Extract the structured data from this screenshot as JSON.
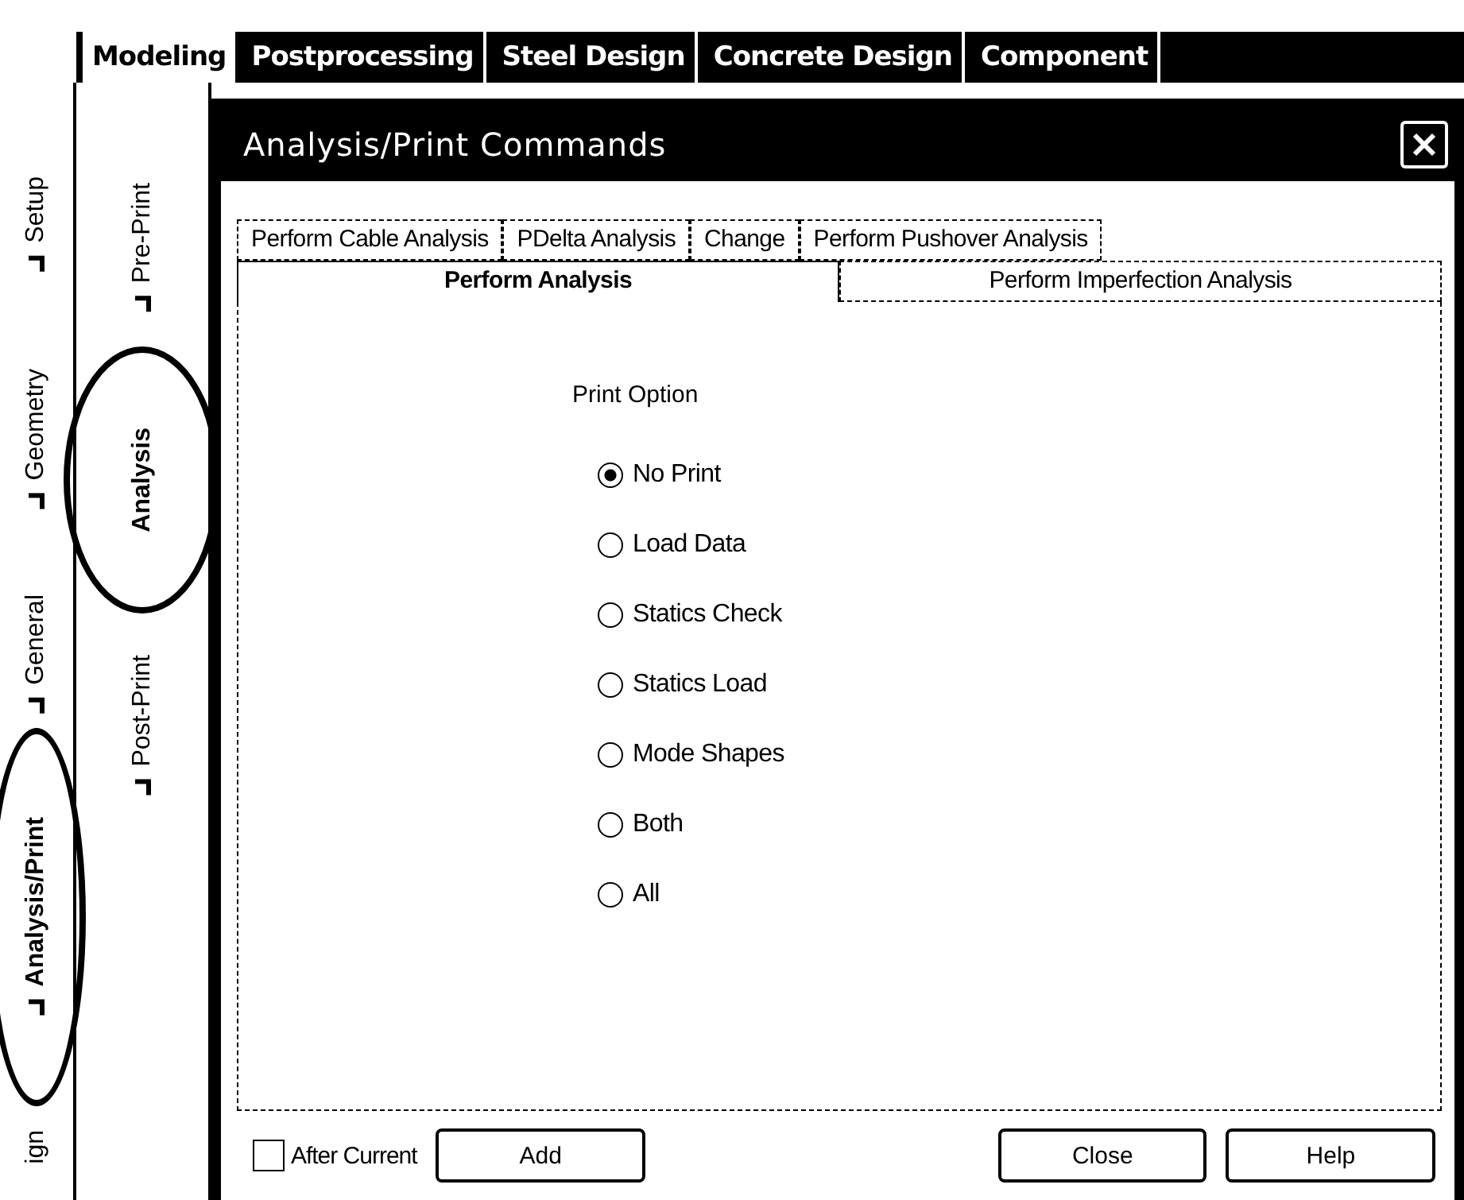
{
  "main_tabs": [
    {
      "label": "Modeling",
      "selected": true
    },
    {
      "label": "Postprocessing",
      "selected": false
    },
    {
      "label": "Steel Design",
      "selected": false
    },
    {
      "label": "Concrete Design",
      "selected": false
    },
    {
      "label": "Component",
      "selected": false
    }
  ],
  "side_tabs": [
    {
      "label": "Setup",
      "selected": false,
      "circled": false,
      "has_icon": true
    },
    {
      "label": "Geometry",
      "selected": false,
      "circled": false,
      "has_icon": true
    },
    {
      "label": "General",
      "selected": false,
      "circled": false,
      "has_icon": true
    },
    {
      "label": "Analysis/Print",
      "selected": true,
      "circled": true,
      "has_icon": true
    },
    {
      "label": "ign",
      "selected": false,
      "circled": false,
      "has_icon": false
    }
  ],
  "sub_tabs": [
    {
      "label": "Pre-Print",
      "selected": false,
      "circled": false
    },
    {
      "label": "Analysis",
      "selected": true,
      "circled": true
    },
    {
      "label": "Post-Print",
      "selected": false,
      "circled": false
    }
  ],
  "dialog": {
    "title": "Analysis/Print Commands",
    "tab_rows": [
      [
        {
          "label": "Perform Cable Analysis",
          "selected": false
        },
        {
          "label": "PDelta Analysis",
          "selected": false
        },
        {
          "label": "Change",
          "selected": false
        },
        {
          "label": "Perform Pushover Analysis",
          "selected": false
        }
      ],
      [
        {
          "label": "Perform Analysis",
          "selected": true
        },
        {
          "label": "Perform Imperfection Analysis",
          "selected": false
        }
      ]
    ],
    "group_label": "Print Option",
    "options": [
      {
        "label": "No Print",
        "selected": true
      },
      {
        "label": "Load Data",
        "selected": false
      },
      {
        "label": "Statics Check",
        "selected": false
      },
      {
        "label": "Statics Load",
        "selected": false
      },
      {
        "label": "Mode Shapes",
        "selected": false
      },
      {
        "label": "Both",
        "selected": false
      },
      {
        "label": "All",
        "selected": false
      }
    ],
    "after_current": {
      "label": "After Current",
      "checked": false
    },
    "buttons": [
      "Add",
      "Close",
      "Help"
    ]
  }
}
